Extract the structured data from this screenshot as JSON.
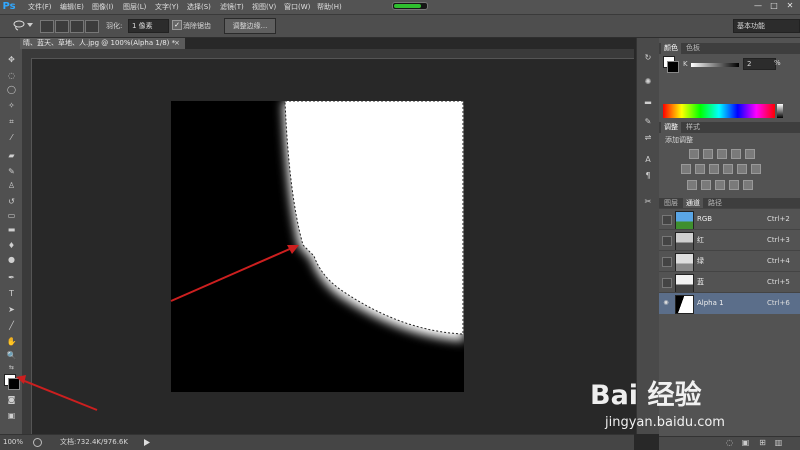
{
  "app": {
    "logo": "Ps"
  },
  "menu": [
    "文件(F)",
    "编辑(E)",
    "图像(I)",
    "图层(L)",
    "文字(Y)",
    "选择(S)",
    "滤镜(T)",
    "视图(V)",
    "窗口(W)",
    "帮助(H)"
  ],
  "progress_fraction": 0.85,
  "window_controls": [
    "—",
    "□",
    "✕"
  ],
  "options": {
    "feather_label": "羽化:",
    "feather_value": "1 像素",
    "antialias_label": "消除锯齿",
    "antialias_checked": true,
    "refine_edge": "调整边缘...",
    "workspace": "基本功能"
  },
  "document": {
    "tab_title": "晴、蓝天、草地、人.jpg @ 100%(Alpha 1/8) *",
    "close": "×"
  },
  "status": {
    "zoom": "100%",
    "doc_info": "文档:732.4K/976.6K"
  },
  "panels": {
    "color_tabs": [
      "颜色",
      "色板"
    ],
    "k_label": "K",
    "k_value": "2",
    "k_unit": "%",
    "adjust_tabs": [
      "调整",
      "样式"
    ],
    "adjust_title": "添加调整",
    "channel_tabs": [
      "图层",
      "通道",
      "路径"
    ],
    "channels": [
      {
        "name": "RGB",
        "shortcut": "Ctrl+2",
        "visible": false
      },
      {
        "name": "红",
        "shortcut": "Ctrl+3",
        "visible": false
      },
      {
        "name": "绿",
        "shortcut": "Ctrl+4",
        "visible": false
      },
      {
        "name": "蓝",
        "shortcut": "Ctrl+5",
        "visible": false
      },
      {
        "name": "Alpha 1",
        "shortcut": "Ctrl+6",
        "visible": true
      }
    ]
  },
  "colors": {
    "foreground": "#ffffff",
    "background": "#000000",
    "annotation_arrow": "#cc1f1f"
  },
  "watermark": {
    "logo": "Bai 经验",
    "url": "jingyan.baidu.com"
  }
}
